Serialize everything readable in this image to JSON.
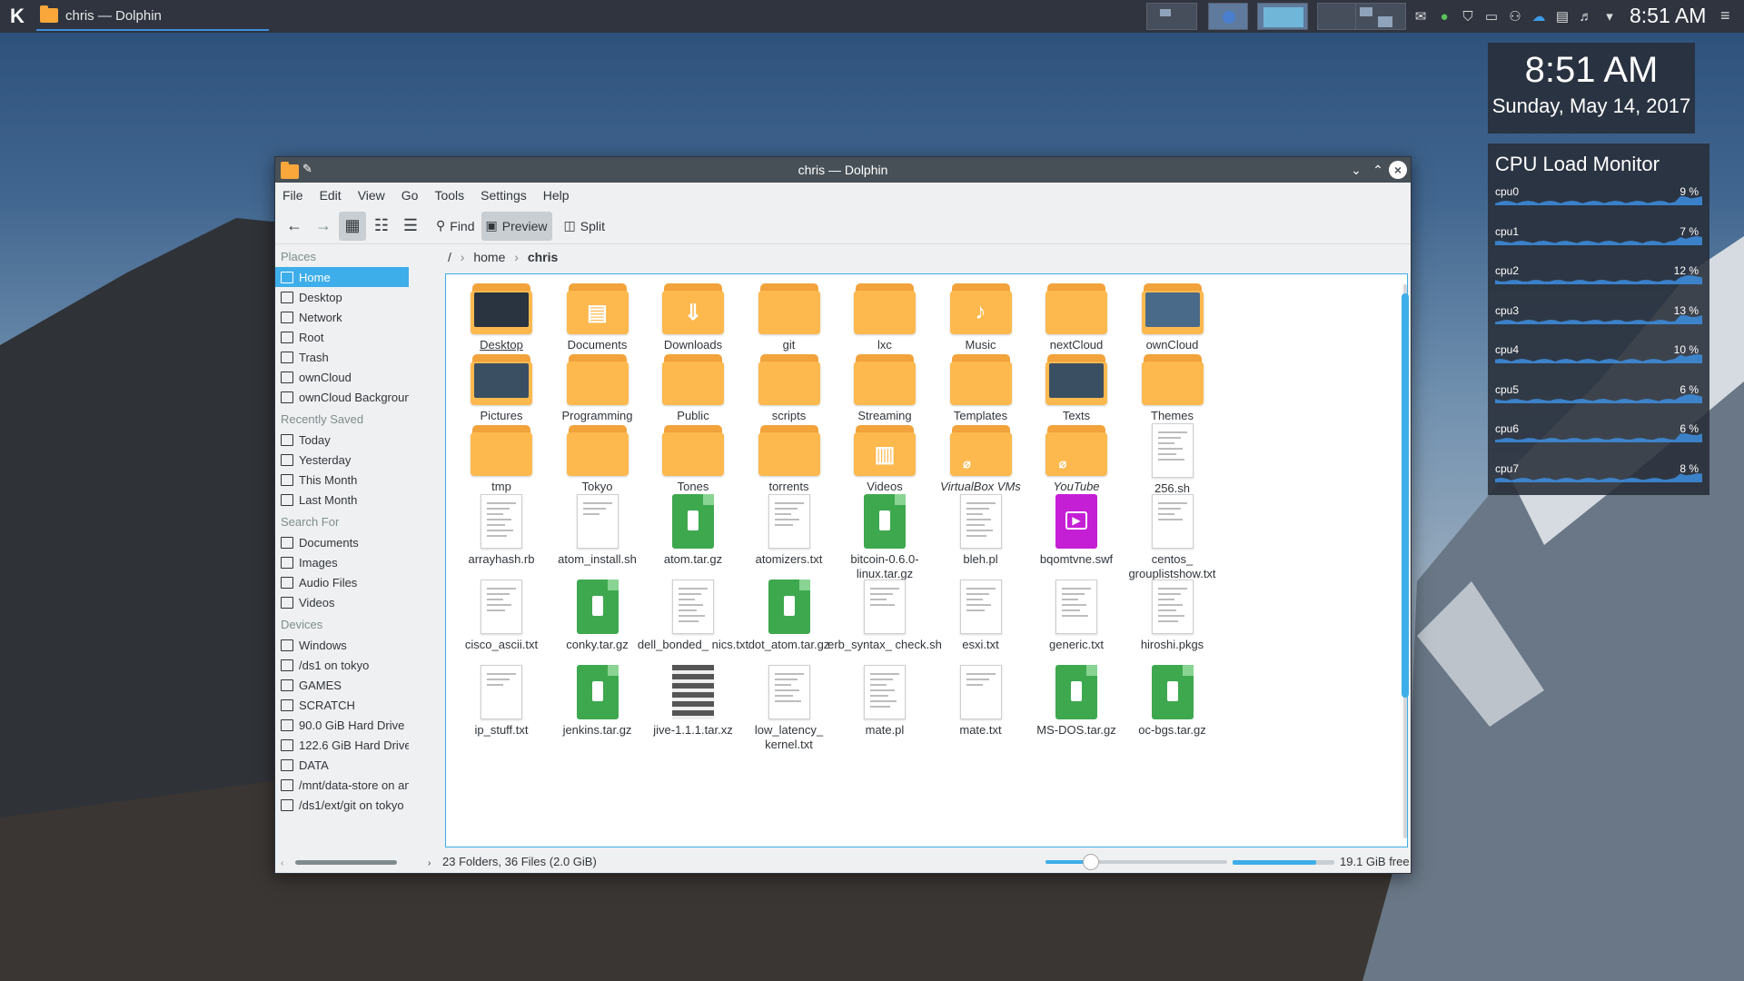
{
  "taskbar": {
    "task_title": "chris — Dolphin",
    "clock": "8:51 AM"
  },
  "clock_widget": {
    "time": "8:51 AM",
    "date": "Sunday, May 14, 2017"
  },
  "cpu_widget": {
    "title": "CPU Load Monitor",
    "cpus": [
      {
        "name": "cpu0",
        "load": "9 %"
      },
      {
        "name": "cpu1",
        "load": "7 %"
      },
      {
        "name": "cpu2",
        "load": "12 %"
      },
      {
        "name": "cpu3",
        "load": "13 %"
      },
      {
        "name": "cpu4",
        "load": "10 %"
      },
      {
        "name": "cpu5",
        "load": "6 %"
      },
      {
        "name": "cpu6",
        "load": "6 %"
      },
      {
        "name": "cpu7",
        "load": "8 %"
      }
    ]
  },
  "window": {
    "title": "chris — Dolphin",
    "menu": [
      "File",
      "Edit",
      "View",
      "Go",
      "Tools",
      "Settings",
      "Help"
    ],
    "toolbar": {
      "find": "Find",
      "preview": "Preview",
      "split": "Split"
    },
    "breadcrumb": {
      "root": "/",
      "home": "home",
      "current": "chris"
    },
    "places": {
      "places_header": "Places",
      "places": [
        "Home",
        "Desktop",
        "Network",
        "Root",
        "Trash",
        "ownCloud",
        "ownCloud Backgrounds"
      ],
      "recent_header": "Recently Saved",
      "recent": [
        "Today",
        "Yesterday",
        "This Month",
        "Last Month"
      ],
      "search_header": "Search For",
      "search": [
        "Documents",
        "Images",
        "Audio Files",
        "Videos"
      ],
      "devices_header": "Devices",
      "devices": [
        "Windows",
        "/ds1 on tokyo",
        "GAMES",
        "SCRATCH",
        "90.0 GiB Hard Drive",
        "122.6 GiB Hard Drive",
        "DATA",
        "/mnt/data-store on amate",
        "/ds1/ext/git on tokyo"
      ]
    },
    "files": [
      {
        "name": "Desktop",
        "kind": "folder-desktop"
      },
      {
        "name": "Documents",
        "kind": "folder",
        "sym": "▤"
      },
      {
        "name": "Downloads",
        "kind": "folder",
        "sym": "⇓"
      },
      {
        "name": "git",
        "kind": "folder"
      },
      {
        "name": "lxc",
        "kind": "folder"
      },
      {
        "name": "Music",
        "kind": "folder",
        "sym": "♪"
      },
      {
        "name": "nextCloud",
        "kind": "folder"
      },
      {
        "name": "ownCloud",
        "kind": "folder-desktop"
      },
      {
        "name": "Pictures",
        "kind": "folder-desktop"
      },
      {
        "name": "Programming",
        "kind": "folder"
      },
      {
        "name": "Public",
        "kind": "folder"
      },
      {
        "name": "scripts",
        "kind": "folder"
      },
      {
        "name": "Streaming",
        "kind": "folder"
      },
      {
        "name": "Templates",
        "kind": "folder"
      },
      {
        "name": "Texts",
        "kind": "folder-desktop"
      },
      {
        "name": "Themes",
        "kind": "folder"
      },
      {
        "name": "tmp",
        "kind": "folder"
      },
      {
        "name": "Tokyo",
        "kind": "folder"
      },
      {
        "name": "Tones",
        "kind": "folder"
      },
      {
        "name": "torrents",
        "kind": "folder"
      },
      {
        "name": "Videos",
        "kind": "folder",
        "sym": "▥"
      },
      {
        "name": "VirtualBox VMs",
        "kind": "folder-link"
      },
      {
        "name": "YouTube",
        "kind": "folder-link"
      },
      {
        "name": "256.sh",
        "kind": "doc"
      },
      {
        "name": "arrayhash.rb",
        "kind": "doc"
      },
      {
        "name": "atom_install.sh",
        "kind": "doc"
      },
      {
        "name": "atom.tar.gz",
        "kind": "archive"
      },
      {
        "name": "atomizers.txt",
        "kind": "doc"
      },
      {
        "name": "bitcoin-0.6.0-linux.tar.gz",
        "kind": "archive"
      },
      {
        "name": "bleh.pl",
        "kind": "doc"
      },
      {
        "name": "bqomtvne.swf",
        "kind": "flash"
      },
      {
        "name": "centos_ grouplistshow.txt",
        "kind": "doc"
      },
      {
        "name": "cisco_ascii.txt",
        "kind": "doc"
      },
      {
        "name": "conky.tar.gz",
        "kind": "archive"
      },
      {
        "name": "dell_bonded_ nics.txt",
        "kind": "doc"
      },
      {
        "name": "dot_atom.tar.gz",
        "kind": "archive"
      },
      {
        "name": "erb_syntax_ check.sh",
        "kind": "doc"
      },
      {
        "name": "esxi.txt",
        "kind": "doc"
      },
      {
        "name": "generic.txt",
        "kind": "doc"
      },
      {
        "name": "hiroshi.pkgs",
        "kind": "doc"
      },
      {
        "name": "ip_stuff.txt",
        "kind": "doc"
      },
      {
        "name": "jenkins.tar.gz",
        "kind": "archive"
      },
      {
        "name": "jive-1.1.1.tar.xz",
        "kind": "xz"
      },
      {
        "name": "low_latency_ kernel.txt",
        "kind": "doc"
      },
      {
        "name": "mate.pl",
        "kind": "doc"
      },
      {
        "name": "mate.txt",
        "kind": "doc"
      },
      {
        "name": "MS-DOS.tar.gz",
        "kind": "archive"
      },
      {
        "name": "oc-bgs.tar.gz",
        "kind": "archive"
      }
    ],
    "status": {
      "summary": "23 Folders, 36 Files (2.0 GiB)",
      "free": "19.1 GiB free",
      "zoom_fraction": 0.25,
      "disk_used_fraction": 0.82
    }
  }
}
